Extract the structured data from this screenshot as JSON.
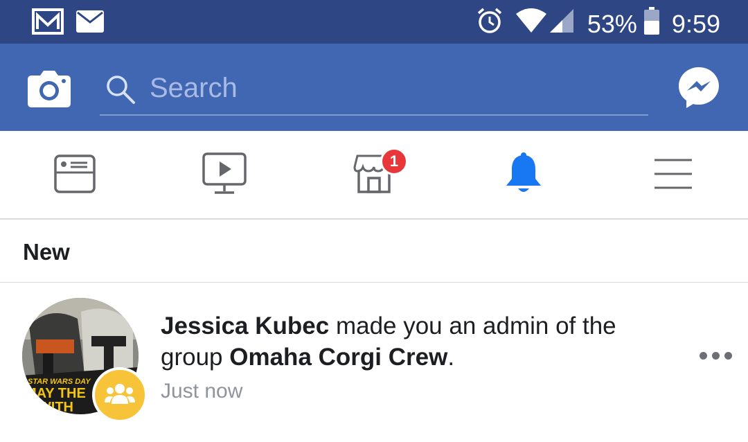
{
  "status_bar": {
    "battery": "53%",
    "time": "9:59",
    "icons": [
      "gmail-icon",
      "email-icon",
      "alarm-icon",
      "wifi-icon",
      "cell-signal-icon",
      "battery-icon"
    ]
  },
  "app_bar": {
    "search_placeholder": "Search",
    "icons": [
      "camera-icon",
      "search-icon",
      "messenger-icon"
    ]
  },
  "tabs": [
    {
      "name": "news-feed",
      "icon": "news-feed-icon"
    },
    {
      "name": "watch",
      "icon": "video-icon"
    },
    {
      "name": "marketplace",
      "icon": "marketplace-icon",
      "badge": "1"
    },
    {
      "name": "notifications",
      "icon": "bell-icon",
      "active": true
    },
    {
      "name": "menu",
      "icon": "hamburger-icon"
    }
  ],
  "colors": {
    "status_bar": "#2f4684",
    "app_bar": "#4267b2",
    "active_tab": "#1877f2",
    "badge": "#e8373a",
    "group_badge": "#f7c338"
  },
  "section_header": "New",
  "notification": {
    "actor": "Jessica Kubec",
    "action": " made you an admin of the group ",
    "group": "Omaha Corgi Crew",
    "end": ".",
    "time": "Just now",
    "avatar_text_1": "STAR WARS DAY",
    "avatar_text_2": "MAY THE",
    "avatar_text_3": "E WITH"
  }
}
